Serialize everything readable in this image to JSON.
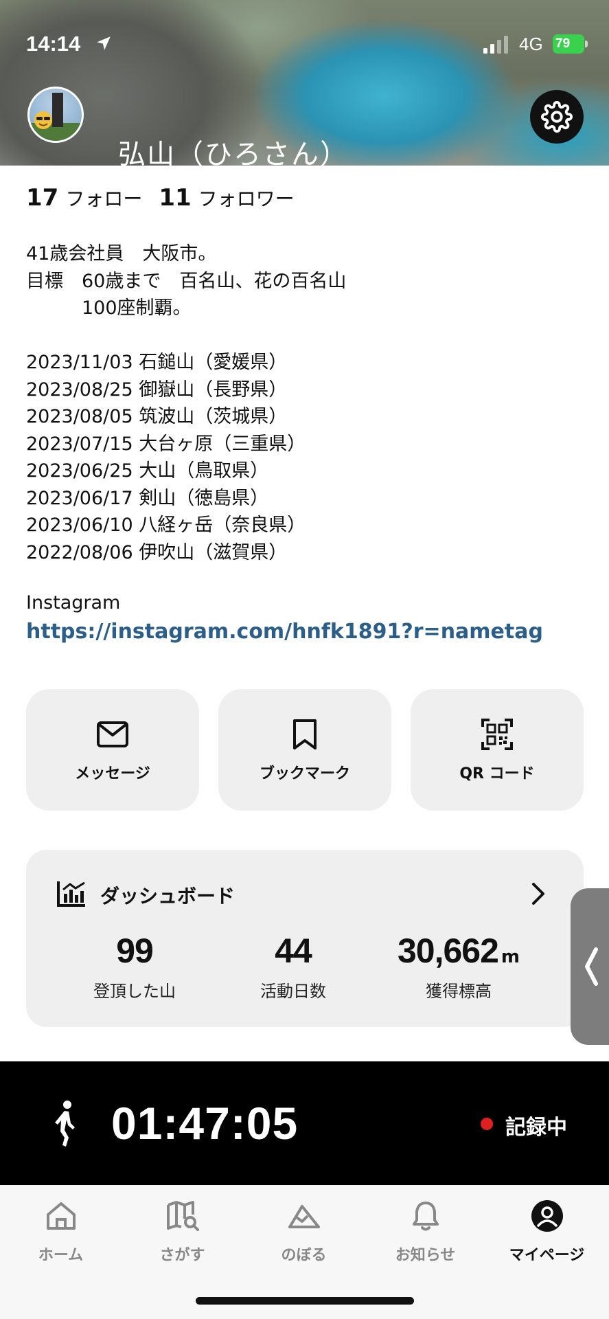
{
  "status_bar": {
    "time": "14:14",
    "network": "4G",
    "battery": "79"
  },
  "profile": {
    "name": "弘山（ひろさん）",
    "following_count": "17",
    "following_label": "フォロー",
    "followers_count": "11",
    "followers_label": "フォロワー",
    "bio": "41歳会社員　大阪市。\n目標　60歳まで　百名山、花の百名山\n　　　100座制覇。\n\n2023/11/03 石鎚山（愛媛県）\n2023/08/25 御嶽山（長野県）\n2023/08/05 筑波山（茨城県）\n2023/07/15 大台ヶ原（三重県）\n2023/06/25 大山（鳥取県）\n2023/06/17 剣山（徳島県）\n2023/06/10 八経ヶ岳（奈良県）\n2022/08/06 伊吹山（滋賀県）",
    "instagram_label": "Instagram",
    "instagram_url": "https://instagram.com/hnfk1891?r=nametag"
  },
  "actions": {
    "message": "メッセージ",
    "bookmark": "ブックマーク",
    "qr": "QR コード"
  },
  "dashboard": {
    "title": "ダッシュボード",
    "stats": [
      {
        "value": "99",
        "unit": "",
        "caption": "登頂した山"
      },
      {
        "value": "44",
        "unit": "",
        "caption": "活動日数"
      },
      {
        "value": "30,662",
        "unit": "m",
        "caption": "獲得標高"
      }
    ]
  },
  "recording": {
    "elapsed": "01:47:05",
    "status": "記録中"
  },
  "tabs": [
    {
      "label": "ホーム",
      "icon": "home-icon",
      "active": false
    },
    {
      "label": "さがす",
      "icon": "map-search-icon",
      "active": false
    },
    {
      "label": "のぼる",
      "icon": "mountain-icon",
      "active": false
    },
    {
      "label": "お知らせ",
      "icon": "bell-icon",
      "active": false
    },
    {
      "label": "マイページ",
      "icon": "user-icon",
      "active": true
    }
  ],
  "colors": {
    "link": "#2b5f8a",
    "record_dot": "#e02020",
    "battery": "#3ad14f"
  }
}
